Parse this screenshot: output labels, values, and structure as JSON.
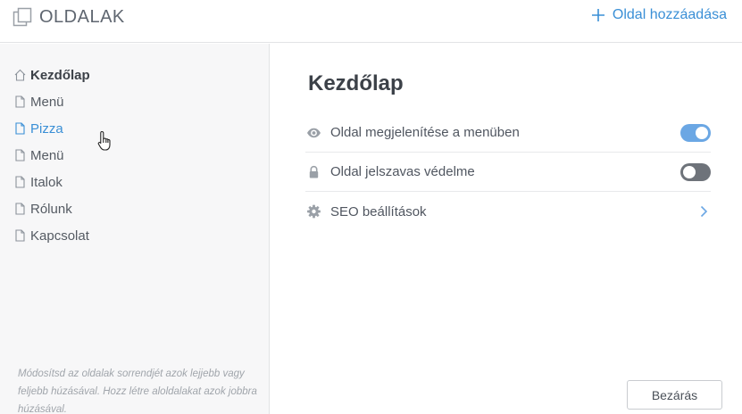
{
  "header": {
    "title": "OLDALAK",
    "add_label": "Oldal hozzáadása"
  },
  "sidebar": {
    "items": [
      {
        "label": "Kezdőlap",
        "icon": "home-icon",
        "state": "active"
      },
      {
        "label": "Menü",
        "icon": "page-icon",
        "state": "normal"
      },
      {
        "label": "Pizza",
        "icon": "page-icon",
        "state": "hover"
      },
      {
        "label": "Menü",
        "icon": "page-icon",
        "state": "normal"
      },
      {
        "label": "Italok",
        "icon": "page-icon",
        "state": "normal"
      },
      {
        "label": "Rólunk",
        "icon": "page-icon",
        "state": "normal"
      },
      {
        "label": "Kapcsolat",
        "icon": "page-icon",
        "state": "normal"
      }
    ],
    "hint": "Módosítsd az oldalak sorrendjét azok lejjebb vagy feljebb húzásával. Hozz létre aloldalakat azok jobbra húzásával."
  },
  "main": {
    "page_title": "Kezdőlap",
    "settings": [
      {
        "label": "Oldal megjelenítése a menüben",
        "icon": "eye-icon",
        "control": "toggle",
        "on": true
      },
      {
        "label": "Oldal jelszavas védelme",
        "icon": "lock-icon",
        "control": "toggle",
        "on": false
      },
      {
        "label": "SEO beállítások",
        "icon": "gear-icon",
        "control": "chevron"
      }
    ],
    "close_label": "Bezárás"
  },
  "colors": {
    "accent": "#3a8fd6",
    "toggle_on": "#6ba7e4",
    "toggle_off": "#6e737a",
    "sidebar_bg": "#f7f7f8"
  }
}
